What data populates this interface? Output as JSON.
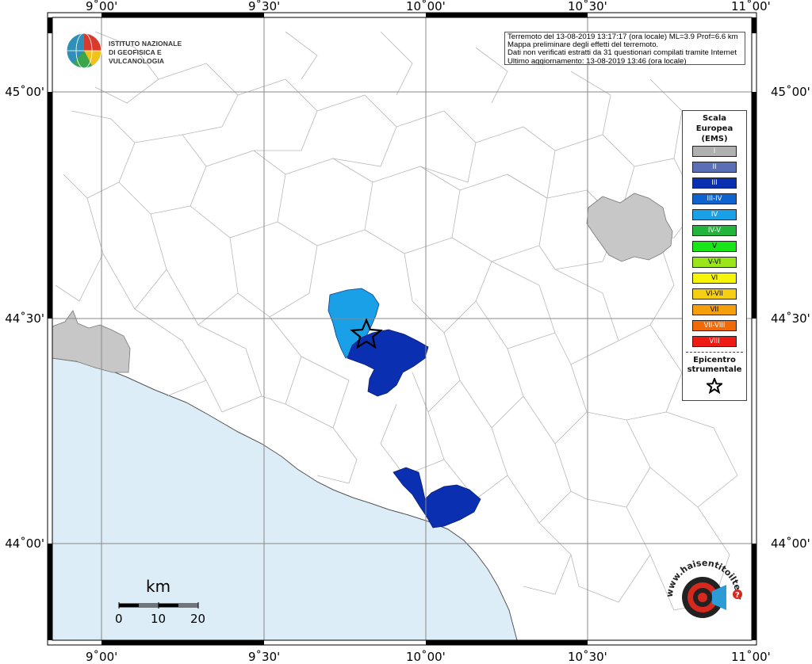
{
  "map": {
    "lon_ticks": [
      "9˚00'",
      "9˚30'",
      "10˚00'",
      "10˚30'",
      "11˚00'"
    ],
    "lat_ticks": [
      "45˚00'",
      "44˚30'",
      "44˚00'"
    ],
    "colors": {
      "sea": "#dcedf8",
      "land": "#ffffff",
      "boundary": "#b8b8b8",
      "grid": "#888888",
      "other_region": "#c7c7c7"
    }
  },
  "info": {
    "line1": "Terremoto del 13-08-2019 13:17:17 (ora locale) ML=3.9 Prof=6.6 km",
    "line2": "Mappa preliminare degli effetti del terremoto.",
    "line3": "Dati non verificati estratti da 31 questionari compilati tramite Internet",
    "line4": "Ultimo aggiornamento: 13-08-2019 13:46 (ora locale)"
  },
  "legend": {
    "title_line1": "Scala",
    "title_line2": "Europea",
    "title_line3": "(EMS)",
    "items": [
      {
        "label": "I",
        "color": "#b0b0b0",
        "text": "#ffffff"
      },
      {
        "label": "II",
        "color": "#5a6fb5",
        "text": "#ffffff"
      },
      {
        "label": "III",
        "color": "#0a2fb0",
        "text": "#ffffff"
      },
      {
        "label": "III-IV",
        "color": "#0e63cf",
        "text": "#ffffff"
      },
      {
        "label": "IV",
        "color": "#1aa0e6",
        "text": "#ffffff"
      },
      {
        "label": "IV-V",
        "color": "#22b53b",
        "text": "#ffffff"
      },
      {
        "label": "V",
        "color": "#19e619",
        "text": "#000000"
      },
      {
        "label": "V-VI",
        "color": "#9be61a",
        "text": "#000000"
      },
      {
        "label": "VI",
        "color": "#f5f50a",
        "text": "#000000"
      },
      {
        "label": "VI-VII",
        "color": "#f5cf14",
        "text": "#000000"
      },
      {
        "label": "VII",
        "color": "#f5a00a",
        "text": "#000000"
      },
      {
        "label": "VII-VIII",
        "color": "#f06a0a",
        "text": "#ffffff"
      },
      {
        "label": "VIII",
        "color": "#ee1a14",
        "text": "#ffffff"
      }
    ],
    "epicenter_line1": "Epicentro",
    "epicenter_line2": "strumentale"
  },
  "scale": {
    "unit": "km",
    "labels": [
      "0",
      "10",
      "20"
    ]
  },
  "logos": {
    "ingv_line1": "ISTITUTO NAZIONALE",
    "ingv_line2": "DI GEOFISICA E VULCANOLOGIA",
    "hst_text": "www.haisentitoilterremoto.it"
  }
}
